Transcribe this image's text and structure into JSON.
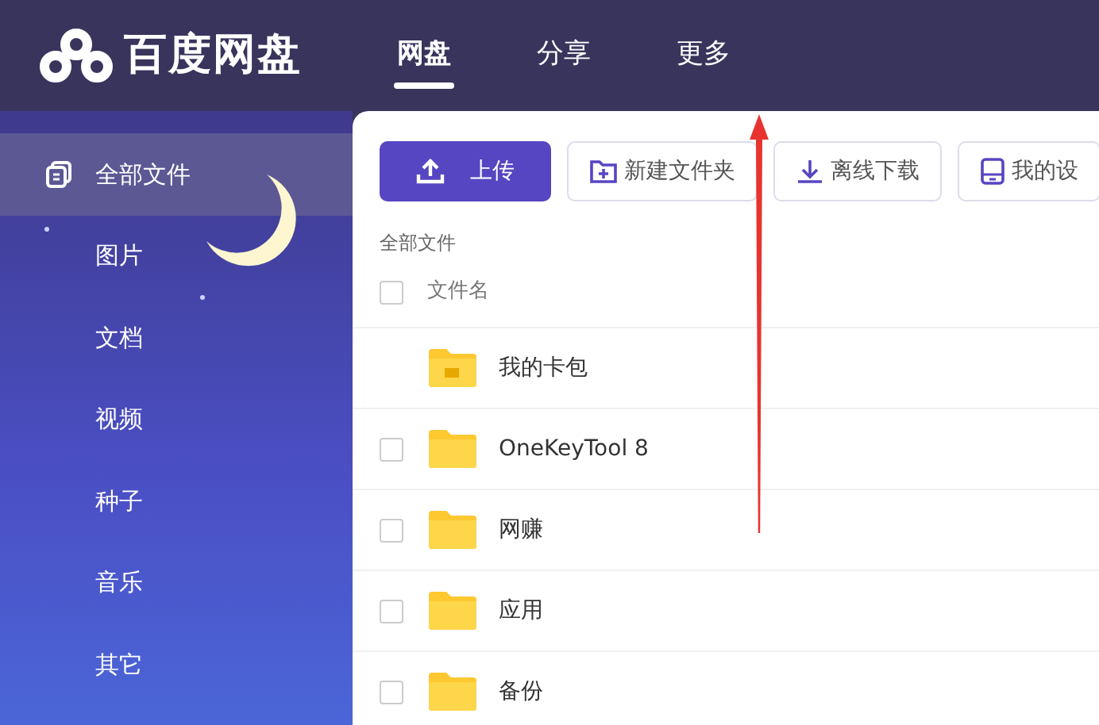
{
  "app": {
    "logo_text": "百度网盘"
  },
  "tabs": [
    {
      "label": "网盘",
      "selected": true
    },
    {
      "label": "分享",
      "selected": false
    },
    {
      "label": "更多",
      "selected": false
    }
  ],
  "sidebar": {
    "items": [
      {
        "label": "全部文件",
        "selected": true,
        "kind": "all"
      },
      {
        "label": "图片",
        "selected": false,
        "kind": "plain"
      },
      {
        "label": "文档",
        "selected": false,
        "kind": "plain"
      },
      {
        "label": "视频",
        "selected": false,
        "kind": "plain"
      },
      {
        "label": "种子",
        "selected": false,
        "kind": "plain"
      },
      {
        "label": "音乐",
        "selected": false,
        "kind": "plain"
      },
      {
        "label": "其它",
        "selected": false,
        "kind": "plain"
      }
    ]
  },
  "toolbar": [
    {
      "label": "上传",
      "kind": "upload"
    },
    {
      "label": "新建文件夹",
      "kind": "new-folder"
    },
    {
      "label": "离线下载",
      "kind": "download"
    },
    {
      "label": "我的设",
      "kind": "device"
    }
  ],
  "breadcrumb": "全部文件",
  "table": {
    "column_header": "文件名",
    "header_checked": false,
    "rows": [
      {
        "name": "我的卡包",
        "kind": "wallet"
      },
      {
        "name": "OneKeyTool 8",
        "kind": "folder",
        "checked": false
      },
      {
        "name": "网赚",
        "kind": "folder",
        "checked": false
      },
      {
        "name": "应用",
        "kind": "folder",
        "checked": false
      },
      {
        "name": "备份",
        "kind": "folder",
        "checked": false
      }
    ]
  },
  "annotation": {
    "kind": "arrow"
  }
}
